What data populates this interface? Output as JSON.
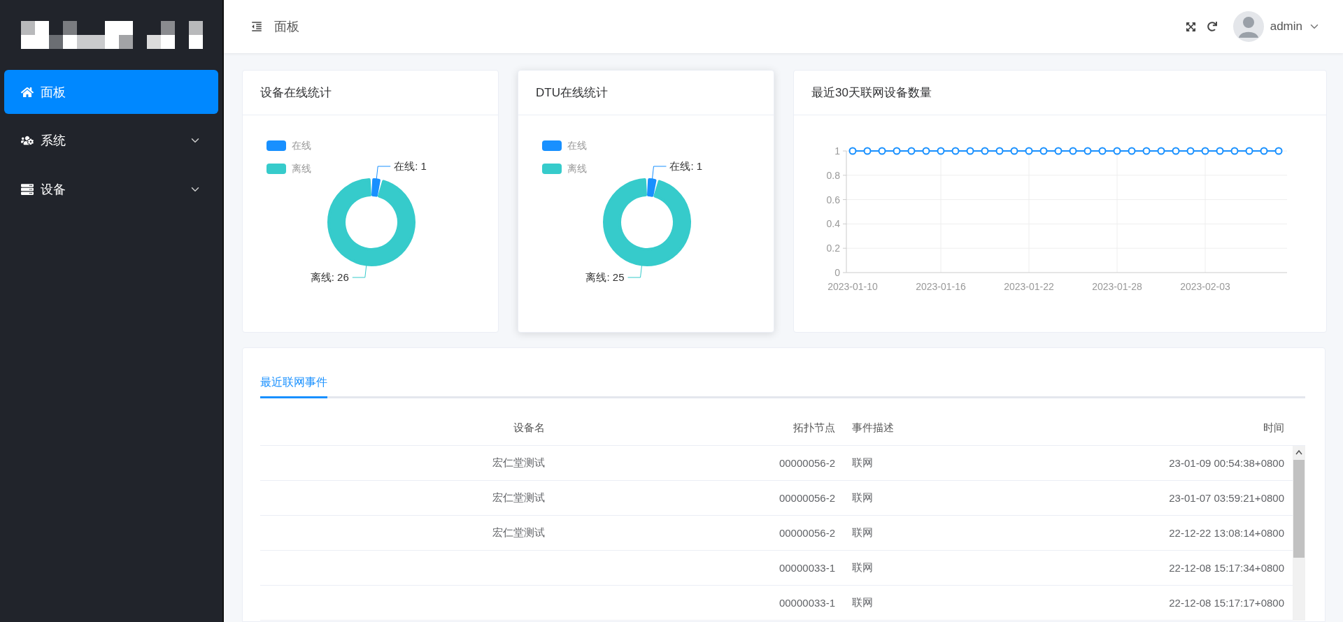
{
  "sidebar": {
    "menu": [
      {
        "label": "面板",
        "kind": "link",
        "selected": true
      },
      {
        "label": "系统",
        "kind": "submenu",
        "selected": false,
        "expanded": false
      },
      {
        "label": "设备",
        "kind": "submenu",
        "selected": false,
        "expanded": false
      }
    ]
  },
  "header": {
    "breadcrumb": "面板",
    "user": {
      "name": "admin"
    }
  },
  "cards": [
    {
      "title": "设备在线统计",
      "raised": false,
      "chart_data": {
        "type": "donut",
        "categories": [
          "在线",
          "离线"
        ],
        "values": [
          1,
          26
        ],
        "legend": "top-left",
        "colors": [
          "#1890ff",
          "#36cbcb"
        ],
        "value_labels": [
          "在线: 1",
          "离线: 26"
        ]
      }
    },
    {
      "title": "DTU在线统计",
      "raised": true,
      "chart_data": {
        "type": "donut",
        "categories": [
          "在线",
          "离线"
        ],
        "values": [
          1,
          25
        ],
        "legend": "top-left",
        "colors": [
          "#1890ff",
          "#36cbcb"
        ],
        "value_labels": [
          "在线: 1",
          "离线: 25"
        ]
      }
    },
    {
      "title": "最近30天联网设备数量",
      "raised": false,
      "chart_data": {
        "type": "line",
        "categories": [
          "2023-01-10",
          null,
          null,
          null,
          null,
          null,
          "2023-01-16",
          null,
          null,
          null,
          null,
          null,
          "2023-01-22",
          null,
          null,
          null,
          null,
          null,
          "2023-01-28",
          null,
          null,
          null,
          null,
          null,
          "2023-02-03",
          null,
          null,
          null,
          null,
          null
        ],
        "grid": true,
        "series": [
          {
            "color": "#1890ff",
            "marker": "circle",
            "values": [
              1,
              1,
              1,
              1,
              1,
              1,
              1,
              1,
              1,
              1,
              1,
              1,
              1,
              1,
              1,
              1,
              1,
              1,
              1,
              1,
              1,
              1,
              1,
              1,
              1,
              1,
              1,
              1,
              1,
              1
            ]
          }
        ],
        "ylim": [
          0,
          1
        ],
        "yticks": [
          0,
          0.2,
          0.4,
          0.6,
          0.8,
          1
        ]
      }
    }
  ],
  "events": {
    "tabs": [
      {
        "label": "最近联网事件",
        "selected": true
      }
    ],
    "table": {
      "columns": [
        "设备名",
        "拓扑节点",
        "事件描述",
        "时间"
      ],
      "rows": [
        {
          "device_name": "宏仁堂测试",
          "topology_node": "00000056-2",
          "event": "联网",
          "time": "23-01-09 00:54:38+0800"
        },
        {
          "device_name": "宏仁堂测试",
          "topology_node": "00000056-2",
          "event": "联网",
          "time": "23-01-07 03:59:21+0800"
        },
        {
          "device_name": "宏仁堂测试",
          "topology_node": "00000056-2",
          "event": "联网",
          "time": "22-12-22 13:08:14+0800"
        },
        {
          "topology_node": "00000033-1",
          "event": "联网",
          "time": "22-12-08 15:17:34+0800"
        },
        {
          "topology_node": "00000033-1",
          "event": "联网",
          "time": "22-12-08 15:17:17+0800"
        }
      ]
    }
  }
}
